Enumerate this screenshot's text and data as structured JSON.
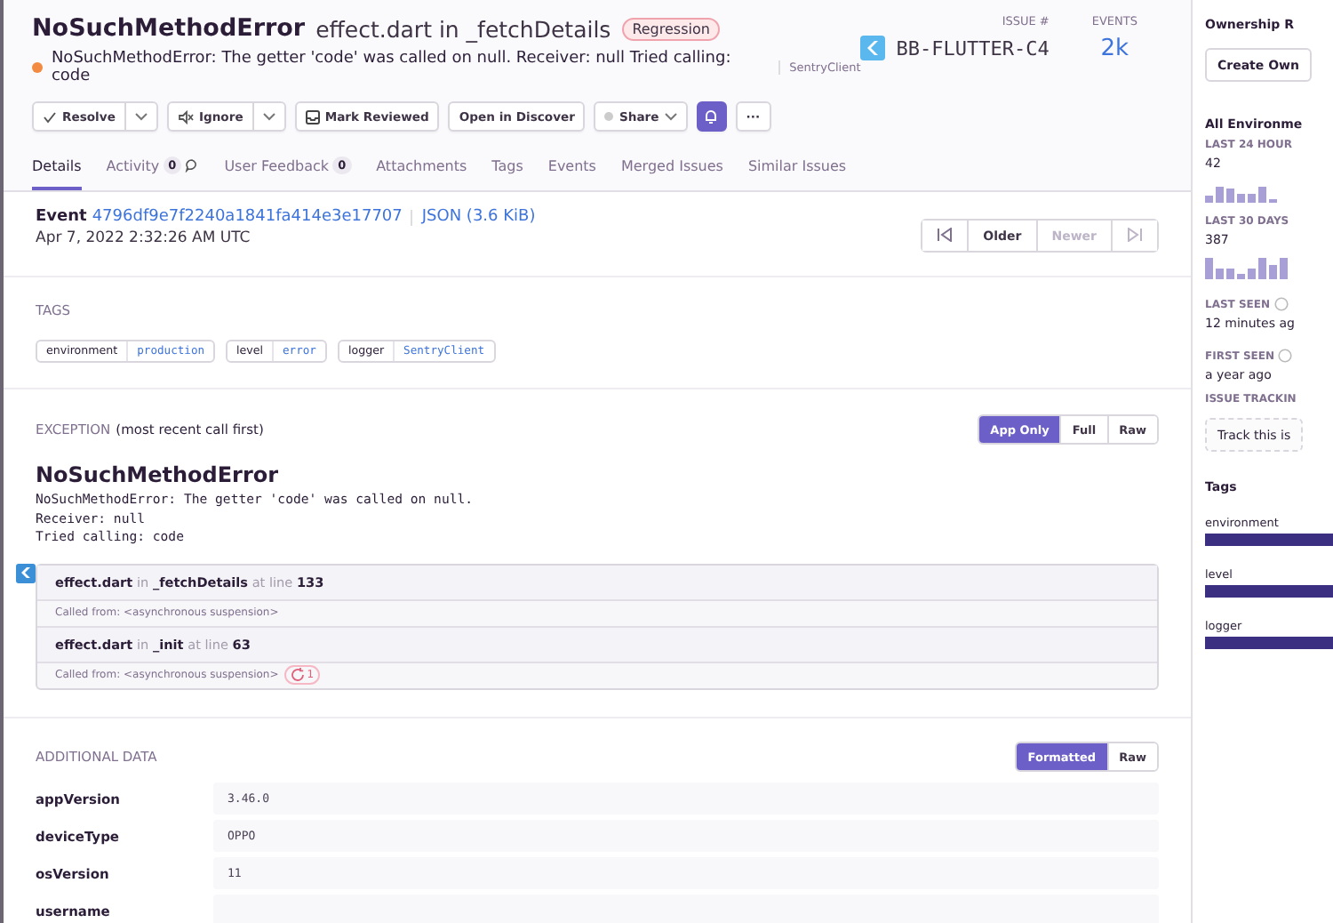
{
  "header": {
    "title": "NoSuchMethodError",
    "culprit": "effect.dart in _fetchDetails",
    "badge": "Regression",
    "message": "NoSuchMethodError: The getter 'code' was called on null. Receiver: null Tried calling: code",
    "logger": "SentryClient",
    "issue_label": "ISSUE #",
    "issue_id": "BB-FLUTTER-C4",
    "events_label": "EVENTS",
    "events": "2k"
  },
  "actions": [
    {
      "kind": "split",
      "label": "Resolve"
    },
    {
      "kind": "split",
      "label": "Ignore"
    },
    {
      "kind": "button",
      "label": "Mark Reviewed"
    },
    {
      "kind": "button",
      "label": "Open in Discover"
    },
    {
      "kind": "dropdown",
      "label": "Share"
    },
    {
      "kind": "bell",
      "on": true
    },
    {
      "kind": "button",
      "label": "···"
    }
  ],
  "tabs": [
    {
      "label": "Details",
      "selected": true
    },
    {
      "label": "Activity",
      "count": "0",
      "selected": false
    },
    {
      "label": "User Feedback",
      "count": "0",
      "selected": false
    },
    {
      "label": "Attachments",
      "selected": false
    },
    {
      "label": "Tags",
      "selected": false
    },
    {
      "label": "Events",
      "selected": false
    },
    {
      "label": "Merged Issues",
      "selected": false
    },
    {
      "label": "Similar Issues",
      "selected": false
    }
  ],
  "event": {
    "label": "Event",
    "id": "4796df9e7f2240a1841fa414e3e17707",
    "json": "JSON (3.6 KiB)",
    "date": "Apr 7, 2022 2:32:26 AM UTC"
  },
  "pager": [
    {
      "kind": "first",
      "disabled": false
    },
    {
      "kind": "text",
      "label": "Older",
      "disabled": false
    },
    {
      "kind": "text",
      "label": "Newer",
      "disabled": true
    },
    {
      "kind": "last",
      "disabled": true
    }
  ],
  "tags": {
    "title": "TAGS",
    "items": [
      {
        "key": "environment",
        "value": "production"
      },
      {
        "key": "level",
        "value": "error"
      },
      {
        "key": "logger",
        "value": "SentryClient"
      }
    ]
  },
  "exception": {
    "title": "EXCEPTION",
    "title_note": "(most recent call first)",
    "views": [
      {
        "label": "App Only",
        "selected": true
      },
      {
        "label": "Full",
        "selected": false
      },
      {
        "label": "Raw",
        "selected": false
      }
    ],
    "type": "NoSuchMethodError",
    "value_lines": [
      "NoSuchMethodError: The getter 'code' was called on null.",
      "Receiver: null",
      "Tried calling: code"
    ],
    "frames": [
      {
        "kind": "frame",
        "file": "effect.dart",
        "in": "in",
        "function": "_fetchDetails",
        "at": "at line",
        "line": "133"
      },
      {
        "kind": "called",
        "text": "Called from: <asynchronous suspension>"
      },
      {
        "kind": "frame",
        "file": "effect.dart",
        "in": "in",
        "function": "_init",
        "at": "at line",
        "line": "63"
      },
      {
        "kind": "called",
        "text": "Called from: <asynchronous suspension>",
        "repeat": "1"
      }
    ]
  },
  "additional": {
    "title": "ADDITIONAL DATA",
    "views": [
      {
        "label": "Formatted",
        "selected": true
      },
      {
        "label": "Raw",
        "selected": false
      }
    ],
    "rows": [
      {
        "key": "appVersion",
        "value": "3.46.0"
      },
      {
        "key": "deviceType",
        "value": "OPPO"
      },
      {
        "key": "osVersion",
        "value": "11"
      },
      {
        "key": "username"
      }
    ]
  },
  "sidebar": {
    "ownership_title": "Ownership R",
    "ownership_button": "Create Own",
    "env_title": "All Environme",
    "stats": [
      {
        "kind": "spark",
        "label": "LAST 24 HOUR",
        "value": "42"
      },
      {
        "kind": "spark",
        "label": "LAST 30 DAYS",
        "value": "387"
      },
      {
        "kind": "time",
        "label": "LAST SEEN",
        "value": "12 minutes ag"
      },
      {
        "kind": "time",
        "label": "FIRST SEEN",
        "value": "a year ago"
      }
    ],
    "tracking_title": "ISSUE TRACKIN",
    "tracking_button": "Track this is",
    "tags_title": "Tags",
    "tags": [
      "environment",
      "level",
      "logger"
    ]
  }
}
